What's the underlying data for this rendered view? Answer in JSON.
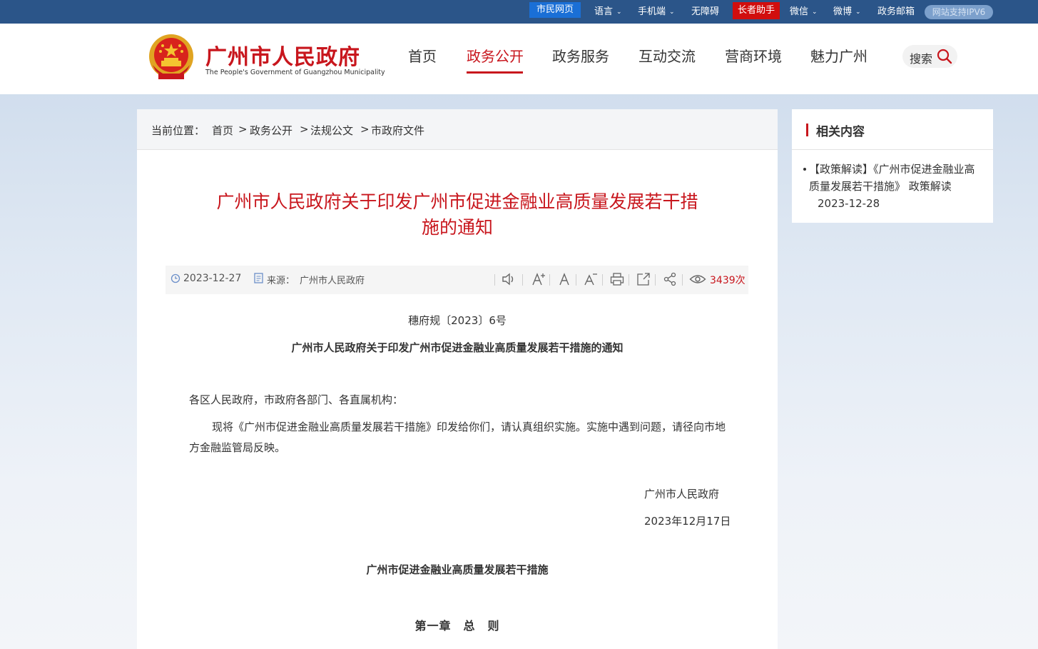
{
  "topbar": {
    "citizen_page": "市民网页",
    "language": "语言",
    "mobile": "手机端",
    "accessibility": "无障碍",
    "elder_assistant": "长者助手",
    "wechat": "微信",
    "weibo": "微博",
    "gov_mail": "政务邮箱",
    "ipv6": "网站支持IPV6"
  },
  "header": {
    "site_name": "广州市人民政府",
    "site_name_en": "The People's Government of Guangzhou Municipality",
    "nav": [
      "首页",
      "政务公开",
      "政务服务",
      "互动交流",
      "营商环境",
      "魅力广州"
    ],
    "active_nav": "政务公开",
    "search_label": "搜索"
  },
  "breadcrumb": {
    "prefix": "当前位置：",
    "items": [
      "首页",
      "政务公开",
      "法规公文",
      "市政府文件"
    ],
    "separator": ">"
  },
  "article": {
    "title": "广州市人民政府关于印发广州市促进金融业高质量发展若干措施的通知",
    "date": "2023-12-27",
    "source_label": "来源：",
    "source": "广州市人民政府",
    "views": "3439次",
    "doc_number": "穗府规〔2023〕6号",
    "subtitle": "广州市人民政府关于印发广州市促进金融业高质量发展若干措施的通知",
    "salutation": "各区人民政府，市政府各部门、各直属机构：",
    "body": "现将《广州市促进金融业高质量发展若干措施》印发给你们，请认真组织实施。实施中遇到问题，请径向市地方金融监管局反映。",
    "signature": "广州市人民政府",
    "sign_date": "2023年12月17日",
    "measures_title": "广州市促进金融业高质量发展若干措施",
    "chapter": "第一章　总　则"
  },
  "toolbar_icons": [
    "speaker-icon",
    "font-increase-icon",
    "font-default-icon",
    "font-decrease-icon",
    "print-icon",
    "open-icon",
    "share-icon",
    "eye-icon"
  ],
  "sidebar": {
    "title": "相关内容",
    "items": [
      {
        "text": "【政策解读】《广州市促进金融业高质量发展若干措施》 政策解读",
        "date": "2023-12-28"
      }
    ]
  },
  "colors": {
    "brand_red": "#c8161d",
    "topbar_blue": "#2b5589",
    "citizen_blue": "#1a6fd6"
  }
}
